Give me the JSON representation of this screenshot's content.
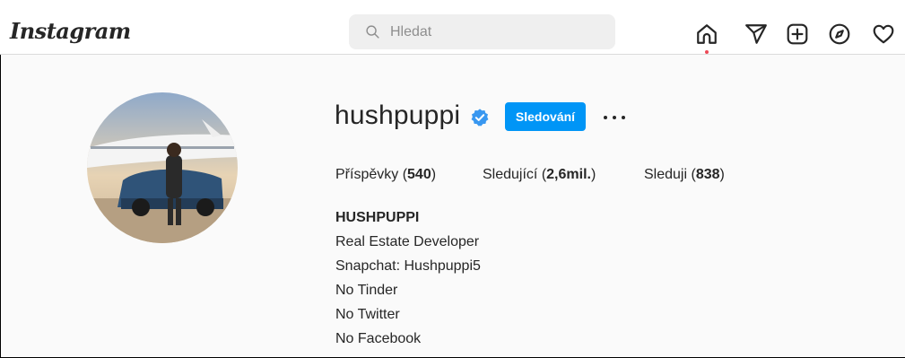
{
  "header": {
    "logo": "Instagram",
    "search_placeholder": "Hledat"
  },
  "nav": {
    "icons": [
      "home-icon",
      "direct-message-icon",
      "new-post-icon",
      "explore-icon",
      "activity-icon"
    ]
  },
  "profile": {
    "username": "hushpuppi",
    "verified": true,
    "follow_button_label": "Sledování",
    "stats": {
      "posts_label": "Příspěvky",
      "posts_count": "540",
      "followers_label": "Sledující",
      "followers_count": "2,6mil.",
      "following_label": "Sleduji",
      "following_count": "838"
    },
    "bio": {
      "name": "HUSHPUPPI",
      "lines": [
        "Real Estate Developer",
        "Snapchat: Hushpuppi5",
        "No Tinder",
        "No Twitter",
        "No Facebook"
      ]
    }
  },
  "colors": {
    "accent": "#0095f6",
    "notification_dot": "#ed4956",
    "background": "#fafafa"
  }
}
